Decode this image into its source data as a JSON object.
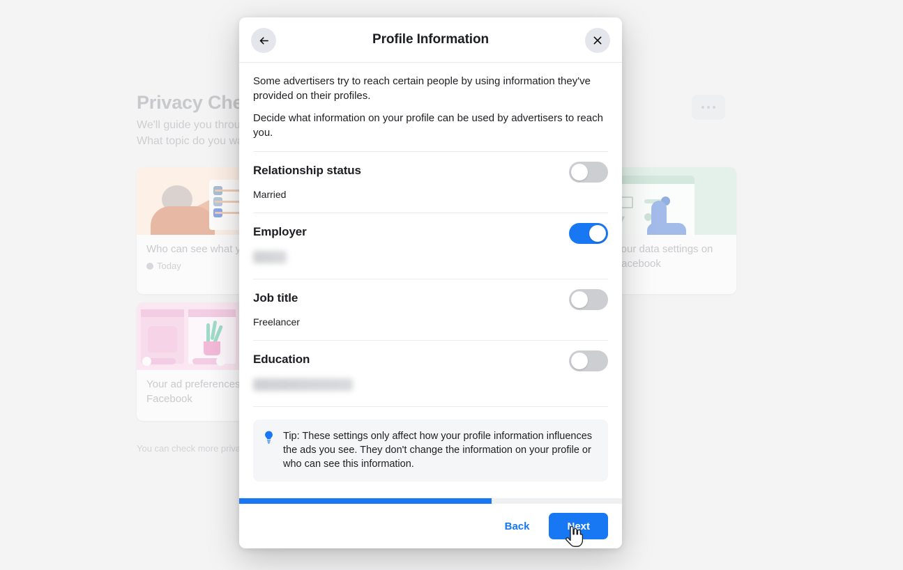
{
  "background": {
    "title": "Privacy Checkup",
    "subtitle_line1": "We'll guide you through some settings so you can make the right choices for your account.",
    "subtitle_line2": "What topic do you want to start with?",
    "menu_icon": "more-options-icon",
    "footer_note": "You can check more privacy settings anytime",
    "cards": [
      {
        "title": "Who can see what you share",
        "status": "Today",
        "status_icon": "check-circle-icon"
      },
      {
        "title": "Your ad preferences on Facebook",
        "status": "",
        "status_icon": ""
      },
      {
        "title": "Your data settings on Facebook",
        "status": "",
        "status_icon": ""
      }
    ]
  },
  "modal": {
    "title": "Profile Information",
    "back_icon": "arrow-left-icon",
    "close_icon": "close-icon",
    "intro": {
      "paragraph1": "Some advertisers try to reach certain people by using information they've provided on their profiles.",
      "paragraph2": "Decide what information on your profile can be used by advertisers to reach you."
    },
    "settings": [
      {
        "label": "Relationship status",
        "value": "Married",
        "redacted": false,
        "enabled": false,
        "toggle_state": "off"
      },
      {
        "label": "Employer",
        "value": "",
        "redacted": true,
        "enabled": true,
        "toggle_state": "on"
      },
      {
        "label": "Job title",
        "value": "Freelancer",
        "redacted": false,
        "enabled": false,
        "toggle_state": "off"
      },
      {
        "label": "Education",
        "value": "",
        "redacted": true,
        "enabled": false,
        "toggle_state": "off"
      }
    ],
    "tip": {
      "icon": "lightbulb-icon",
      "text": "Tip: These settings only affect how your profile information influences the ads you see. They don't change the information on your profile or who can see this information."
    },
    "progress": {
      "percent": 66
    },
    "footer": {
      "back_label": "Back",
      "next_label": "Next"
    }
  },
  "colors": {
    "accent_blue": "#1877f2",
    "toggle_off": "#ccced2",
    "page_background": "#f4f4f5",
    "tip_background": "#f5f6f7"
  },
  "cursor": {
    "icon": "hand-pointer-cursor"
  }
}
